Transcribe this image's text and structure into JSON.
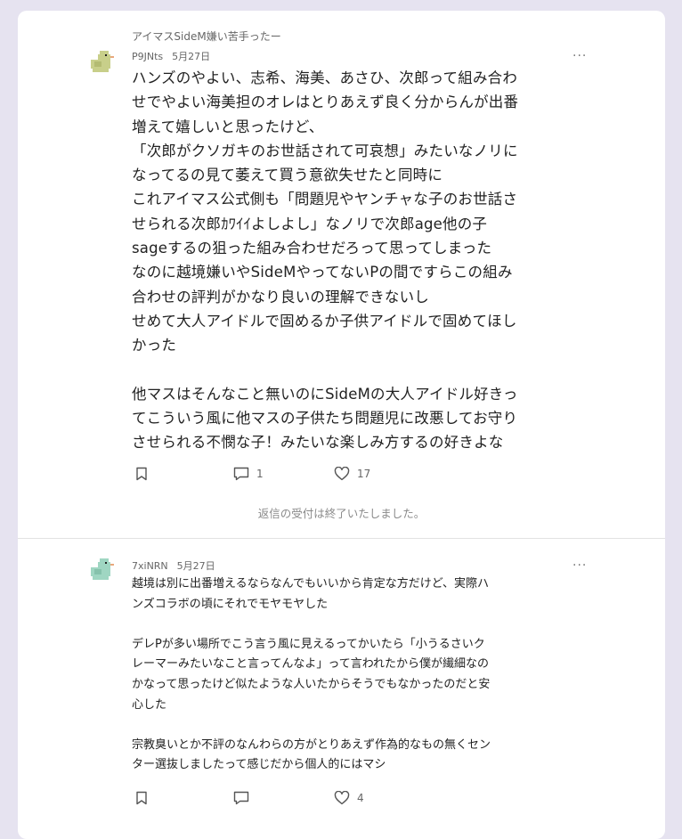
{
  "posts": [
    {
      "topic": "アイマスSideM嫌い苦手ったー",
      "user": "P9JNts",
      "date": "5月27日",
      "more": "···",
      "body": "ハンズのやよい、志希、海美、あさひ、次郎って組み合わ\nせでやよい海美担のオレはとりあえず良く分からんが出番\n増えて嬉しいと思ったけど、\n「次郎がクソガキのお世話されて可哀想」みたいなノリに\nなってるの見て萎えて買う意欲失せたと同時に\nこれアイマス公式側も「問題児やヤンチャな子のお世話さ\nせられる次郎ｶﾜｲｲよしよし」なノリで次郎age他の子\nsageするの狙った組み合わせだろって思ってしまった\nなのに越境嫌いやSideMやってないPの間ですらこの組み\n合わせの評判がかなり良いの理解できないし\nせめて大人アイドルで固めるか子供アイドルで固めてほし\nかった\n\n他マスはそんなこと無いのにSideMの大人アイドル好きっ\nてこういう風に他マスの子供たち問題児に改悪してお守り\nさせられる不憫な子！みたいな楽しみ方するの好きよな",
      "reply_count": "1",
      "like_count": "17",
      "avatar_color": "#c8cf8a",
      "closed_notice": "返信の受付は終了いたしました。"
    },
    {
      "user": "7xiNRN",
      "date": "5月27日",
      "more": "···",
      "body": "越境は別に出番増えるならなんでもいいから肯定な方だけど、実際ハ\nンズコラボの頃にそれでモヤモヤした\n\nデレPが多い場所でこう言う風に見えるってかいたら「小うるさいク\nレーマーみたいなこと言ってんなよ」って言われたから僕が繊細なの\nかなって思ったけど似たような人いたからそうでもなかったのだと安\n心した\n\n宗教臭いとか不評のなんわらの方がとりあえず作為的なもの無くセン\nター選抜しましたって感じだから個人的にはマシ",
      "reply_count": "",
      "like_count": "4",
      "avatar_color": "#9fd6c2"
    }
  ],
  "icons": [
    "bookmark-icon",
    "comment-icon",
    "heart-icon",
    "more-icon"
  ]
}
